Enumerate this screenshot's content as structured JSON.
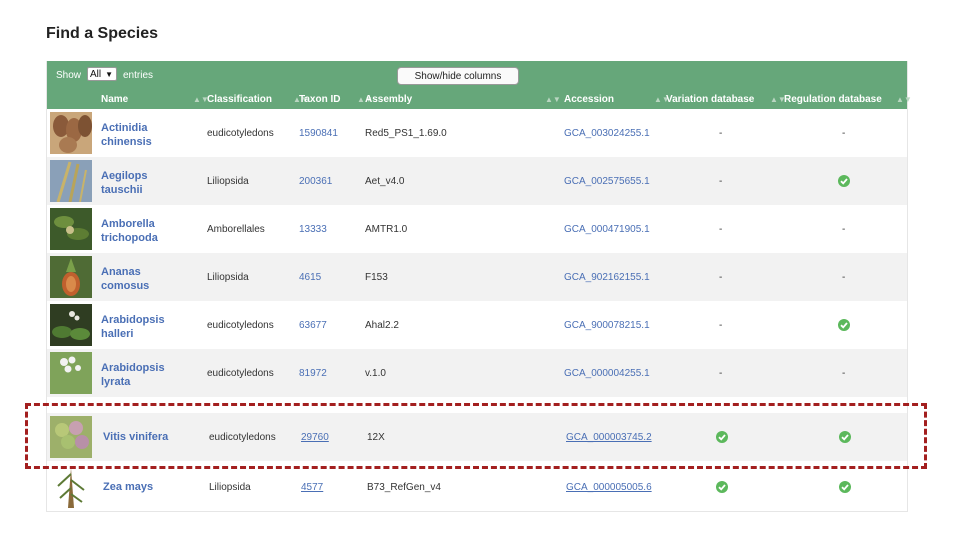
{
  "page": {
    "title": "Find a Species"
  },
  "toolbar": {
    "show_label": "Show",
    "entries_value": "All",
    "entries_label": "entries",
    "toggle_button": "Show/hide columns"
  },
  "columns": [
    "Name",
    "Classification",
    "Taxon ID",
    "Assembly",
    "Accession",
    "Variation database",
    "Regulation database"
  ],
  "rows": [
    {
      "name_line1": "Actinidia",
      "name_line2": "chinensis",
      "classification": "eudicotyledons",
      "taxon_id": "1590841",
      "assembly": "Red5_PS1_1.69.0",
      "accession": "GCA_003024255.1",
      "variation": "-",
      "regulation": "-"
    },
    {
      "name_line1": "Aegilops",
      "name_line2": "tauschii",
      "classification": "Liliopsida",
      "taxon_id": "200361",
      "assembly": "Aet_v4.0",
      "accession": "GCA_002575655.1",
      "variation": "-",
      "regulation": "check"
    },
    {
      "name_line1": "Amborella",
      "name_line2": "trichopoda",
      "classification": "Amborellales",
      "taxon_id": "13333",
      "assembly": "AMTR1.0",
      "accession": "GCA_000471905.1",
      "variation": "-",
      "regulation": "-"
    },
    {
      "name_line1": "Ananas",
      "name_line2": "comosus",
      "classification": "Liliopsida",
      "taxon_id": "4615",
      "assembly": "F153",
      "accession": "GCA_902162155.1",
      "variation": "-",
      "regulation": "-"
    },
    {
      "name_line1": "Arabidopsis",
      "name_line2": "halleri",
      "classification": "eudicotyledons",
      "taxon_id": "63677",
      "assembly": "Ahal2.2",
      "accession": "GCA_900078215.1",
      "variation": "-",
      "regulation": "check"
    },
    {
      "name_line1": "Arabidopsis",
      "name_line2": "lyrata",
      "classification": "eudicotyledons",
      "taxon_id": "81972",
      "assembly": "v.1.0",
      "accession": "GCA_000004255.1",
      "variation": "-",
      "regulation": "-"
    },
    {
      "name_line1": "Vitis vinifera",
      "name_line2": "",
      "classification": "eudicotyledons",
      "taxon_id": "29760",
      "assembly": "12X",
      "accession": "GCA_000003745.2",
      "variation": "check",
      "regulation": "check"
    },
    {
      "name_line1": "Zea mays",
      "name_line2": "",
      "classification": "Liliopsida",
      "taxon_id": "4577",
      "assembly": "B73_RefGen_v4",
      "accession": "GCA_000005005.6",
      "variation": "check",
      "regulation": "check"
    }
  ],
  "colors": {
    "header": "#66a77a",
    "link": "#4a6fb5",
    "highlight": "#a31f1f",
    "check": "#5cb85c"
  }
}
